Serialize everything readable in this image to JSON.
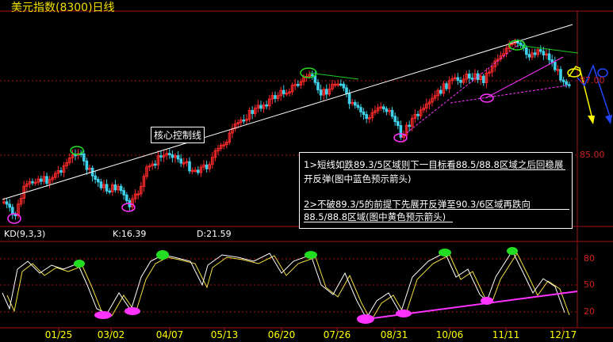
{
  "header": {
    "title": "美元指数(8300)日线"
  },
  "indicator": {
    "name": "KD(9,3,3)",
    "k": "K:16.39",
    "d": "D:21.59"
  },
  "price_axis": {
    "labels": [
      "87.00",
      "85.00"
    ]
  },
  "kd_axis": {
    "labels": [
      "80",
      "50",
      "20"
    ]
  },
  "x_axis": {
    "labels": [
      "01/25",
      "03/02",
      "04/07",
      "05/13",
      "06/20",
      "07/26",
      "08/31",
      "10/06",
      "11/11",
      "12/17"
    ]
  },
  "annotations": {
    "core_line": "核心控制线",
    "note_1a": "1>短线如跌89.3/5区域则下一目标看88.5/88.8区域之后回稳展",
    "note_1b": "开反弹(图中蓝色预示箭头)",
    "note_2a": "2>不破89.3/5的前提下先展开反弹至90.3/6区域再跌向",
    "note_2b": "88.5/88.8区域(图中黄色预示箭头)"
  },
  "colors": {
    "background": "#000000",
    "up_candle": "#ff2a2a",
    "down_candle": "#3fd0e8",
    "trend_line": "#ffffff",
    "kd_k": "#ffffff",
    "kd_d": "#f0e040",
    "marker_green": "#22dd22",
    "marker_magenta": "#ff33ff",
    "arrow_blue": "#2244ff",
    "arrow_yellow": "#ffff00",
    "grid": "#a01010"
  }
}
